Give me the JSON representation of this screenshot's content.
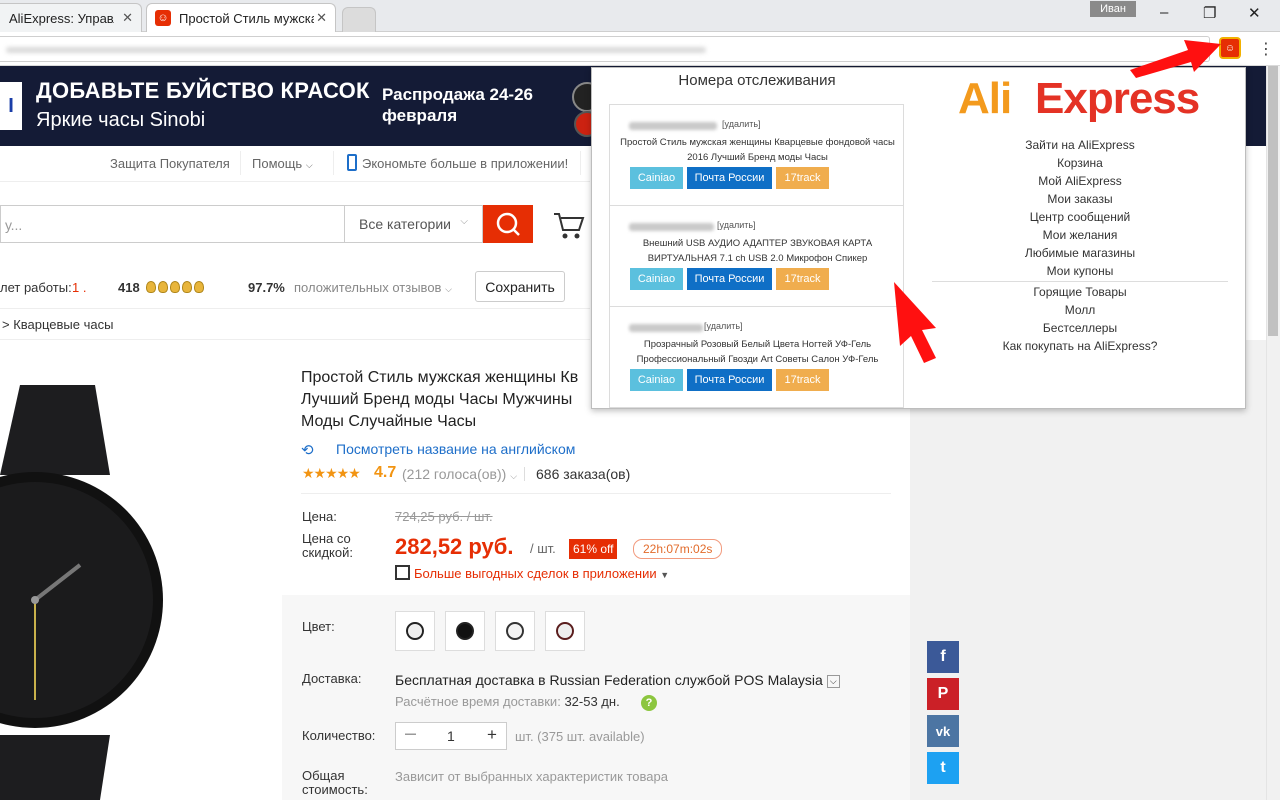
{
  "browser": {
    "tabs": [
      {
        "title": "AliExpress: Управля"
      },
      {
        "title": "Простой Стиль мужска"
      }
    ],
    "user": "Иван",
    "window_buttons": [
      "–",
      "❐",
      "✕"
    ]
  },
  "banner": {
    "headline": "ДОБАВЬТЕ БУЙСТВО КРАСОК",
    "subheadline": "Яркие часы Sinobi",
    "sale": "Распродажа 24-26 февраля"
  },
  "top_nav": {
    "buyer_protection": "Защита Покупателя",
    "help": "Помощь",
    "app": "Экономьте больше в приложении!"
  },
  "search": {
    "placeholder": "у...",
    "category": "Все категории"
  },
  "seller": {
    "years_label": "лет работы:",
    "years_value": "1 .",
    "score": "418",
    "positive": "97.7%",
    "positive_label": "положительных отзывов",
    "save_label": "Сохранить"
  },
  "breadcrumb": "> Кварцевые часы",
  "product": {
    "title": "Простой Стиль мужская женщины Кв Лучший Бренд моды Часы Мужчины Моды Случайные Часы",
    "translate_link": "Посмотреть название на английском",
    "stars": "★★★★★",
    "rating": "4.7",
    "votes": "(212 голоса(ов))",
    "orders": "686 заказа(ов)",
    "price_label": "Цена:",
    "old_price": "724,25 руб. / шт.",
    "discount_price_label": "Цена со скидкой:",
    "new_price": "282,52 руб.",
    "unit": "/ шт.",
    "discount": "61% off",
    "timer": "22h:07m:02s",
    "app_deals": "Больше выгодных сделок в приложении",
    "color_label": "Цвет:",
    "shipping_label": "Доставка:",
    "shipping_text": "Бесплатная доставка в Russian Federation службой POS Malaysia",
    "shipping_time_label": "Расчётное время доставки:",
    "shipping_time": "32-53 дн.",
    "quantity_label": "Количество:",
    "quantity": "1",
    "qty_minus": "—",
    "qty_plus": "+",
    "availability": "шт. (375 шт. available)",
    "total_label": "Общая стоимость:",
    "total_value": "Зависит от выбранных характеристик товара"
  },
  "social": [
    "f",
    "P",
    "vk",
    "t"
  ],
  "popup": {
    "heading": "Номера отслеживания",
    "tracks": [
      {
        "delete": "[удалить]",
        "description": "Простой Стиль мужская женщины Кварцевые фондовой часы 2016 Лучший Бренд моды Часы",
        "btn_cainiao": "Cainiao",
        "btn_pochta": "Почта России",
        "btn_17": "17track"
      },
      {
        "delete": "[удалить]",
        "description": "Внешний USB АУДИО АДАПТЕР ЗВУКОВАЯ КАРТА ВИРТУАЛЬНАЯ 7.1 ch USB 2.0 Микрофон Спикер",
        "btn_cainiao": "Cainiao",
        "btn_pochta": "Почта России",
        "btn_17": "17track"
      },
      {
        "delete": "[удалить]",
        "description": "Прозрачный Розовый Белый Цвета Ногтей УФ-Гель Профессиональный Гвозди Art Советы Салон УФ-Гель",
        "btn_cainiao": "Cainiao",
        "btn_pochta": "Почта России",
        "btn_17": "17track"
      }
    ],
    "logo_ali": "Ali",
    "logo_express": "Express",
    "menu": [
      "Зайти на AliExpress",
      "Корзина",
      "Мой AliExpress",
      "Мои заказы",
      "Центр сообщений",
      "Мои желания",
      "Любимые магазины",
      "Мои купоны"
    ],
    "menu2": [
      "Горящие Товары",
      "Молл",
      "Бестселлеры",
      "Как покупать на AliExpress?"
    ]
  },
  "colors": {
    "accent": "#e62e04",
    "banner_bg": "#141b36",
    "link": "#1d6ec9",
    "star": "#f29412"
  }
}
